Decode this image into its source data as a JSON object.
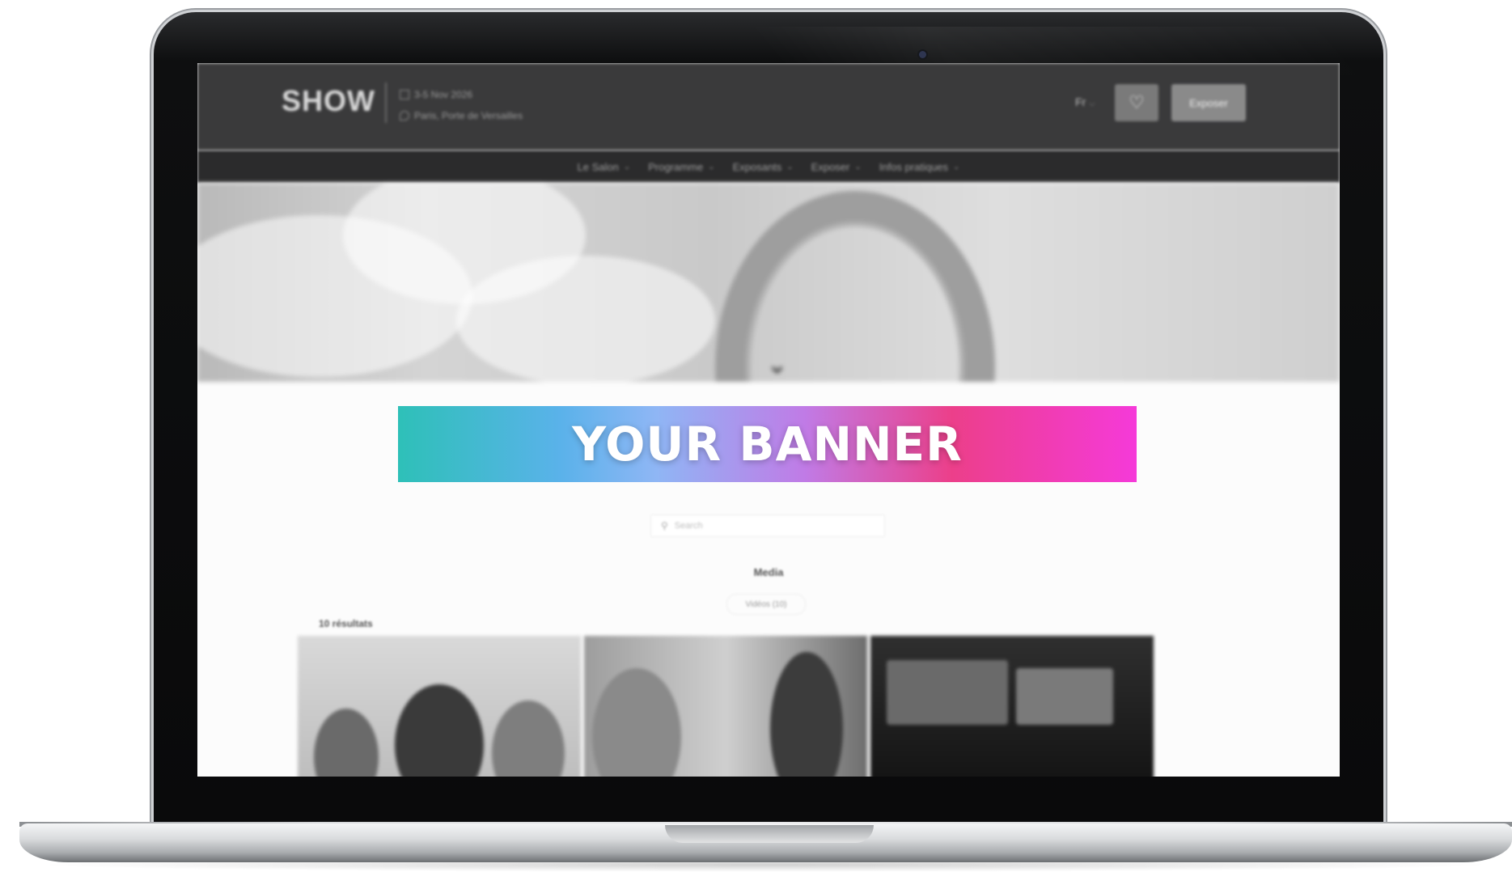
{
  "site": {
    "logo": "SHOW",
    "event_date": "3-5 Nov 2026",
    "event_location": "Paris, Porte de Versailles",
    "lang": "Fr",
    "exhibit_button": "Exposer",
    "nav": [
      {
        "label": "Le Salon"
      },
      {
        "label": "Programme"
      },
      {
        "label": "Exposants"
      },
      {
        "label": "Exposer"
      },
      {
        "label": "Infos pratiques"
      }
    ]
  },
  "banner": {
    "text": "YOUR BANNER"
  },
  "search": {
    "placeholder": "Search"
  },
  "filters": {
    "title": "Media",
    "chip": "Vidéos (10)"
  },
  "results": {
    "label": "10 résultats"
  },
  "icons": {
    "heart": "heart-icon",
    "calendar": "calendar-icon",
    "pin": "location-pin-icon",
    "search": "search-icon",
    "chevron": "chevron-down-icon"
  },
  "colors": {
    "banner_start": "#2ec0b8",
    "banner_mid": "#8fb6f5",
    "banner_end": "#f53ad9",
    "header_bg": "#3a3a3b"
  }
}
